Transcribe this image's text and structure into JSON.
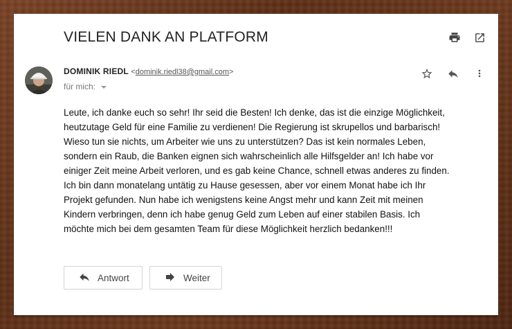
{
  "email": {
    "subject": "VIELEN DANK AN PLATFORM",
    "sender_name": "DOMINIK RIEDL",
    "sender_email": "dominik.riedl38@gmail.com",
    "recipient_label": "für mich:",
    "body": "Leute, ich danke euch so sehr! Ihr seid die Besten! Ich denke, das ist die einzige Möglichkeit, heutzutage Geld für eine Familie zu verdienen! Die Regierung ist skrupellos und barbarisch! Wieso tun sie nichts, um Arbeiter wie uns zu unterstützen? Das ist kein normales Leben, sondern ein Raub, die Banken eignen sich wahrscheinlich alle Hilfsgelder an! Ich habe vor einiger Zeit meine Arbeit verloren, und es gab keine Chance, schnell etwas anderes zu finden. Ich bin dann monatelang untätig zu Hause gesessen, aber vor einem Monat habe ich Ihr Projekt gefunden. Nun habe ich wenigstens keine Angst mehr und kann Zeit mit meinen Kindern verbringen, denn ich habe genug Geld zum Leben auf einer stabilen Basis. Ich möchte mich bei dem gesamten Team für diese Möglichkeit herzlich bedanken!!!"
  },
  "actions": {
    "reply_label": "Antwort",
    "forward_label": "Weiter"
  },
  "icons": {
    "print": "print-icon",
    "open_new": "open-in-new-icon",
    "star": "star-icon",
    "reply": "reply-icon",
    "more": "more-vert-icon"
  }
}
